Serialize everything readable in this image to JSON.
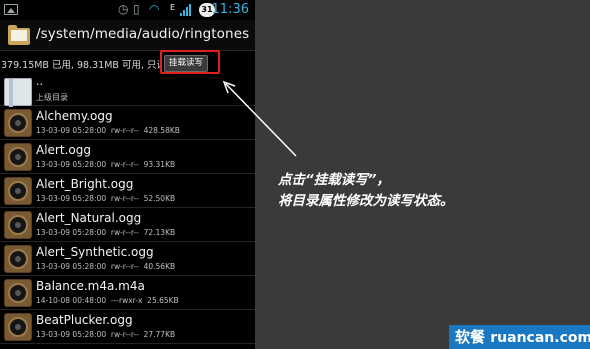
{
  "status_bar": {
    "network_label": "E",
    "battery_level": "31",
    "time": "11:36"
  },
  "path_bar": {
    "path": "/system/media/audio/ringtones"
  },
  "storage_bar": {
    "info": "379.15MB 已用, 98.31MB 可用, 只读",
    "mount_button_label": "挂载读写"
  },
  "parent_dir": {
    "name": "..",
    "label": "上级目录"
  },
  "files": [
    {
      "name": "Alchemy.ogg",
      "meta": "13-03-09 05:28:00  rw-r--r--  428.58KB"
    },
    {
      "name": "Alert.ogg",
      "meta": "13-03-09 05:28:00  rw-r--r--  93.31KB"
    },
    {
      "name": "Alert_Bright.ogg",
      "meta": "13-03-09 05:28:00  rw-r--r--  52.50KB"
    },
    {
      "name": "Alert_Natural.ogg",
      "meta": "13-03-09 05:28:00  rw-r--r--  72.13KB"
    },
    {
      "name": "Alert_Synthetic.ogg",
      "meta": "13-03-09 05:28:00  rw-r--r--  40.56KB"
    },
    {
      "name": "Balance.m4a.m4a",
      "meta": "14-10-08 00:48:00  ---rwxr-x  25.65KB"
    },
    {
      "name": "BeatPlucker.ogg",
      "meta": "13-03-09 05:28:00  rw-r--r--  27.77KB"
    }
  ],
  "annotation": {
    "line1": "点击“挂载读写”，",
    "line2": "将目录属性修改为读写状态。"
  },
  "watermark": {
    "cn": "软餐",
    "en": "ruancan.com"
  },
  "colors": {
    "accent": "#33b5e5",
    "highlight": "#e0201c",
    "watermark_bg": "#1a78c2"
  }
}
